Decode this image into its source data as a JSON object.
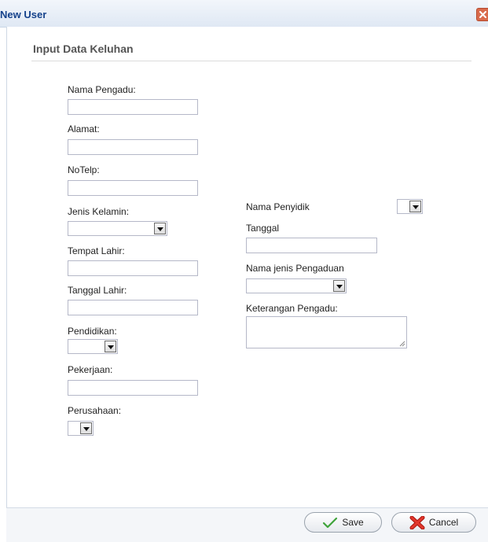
{
  "window": {
    "title": "New User"
  },
  "form": {
    "section_title": "Input Data Keluhan",
    "left": {
      "nama_pengadu": {
        "label": "Nama Pengadu:",
        "value": ""
      },
      "alamat": {
        "label": "Alamat:",
        "value": ""
      },
      "notelp": {
        "label": "NoTelp:",
        "value": ""
      },
      "jenis_kelamin": {
        "label": "Jenis Kelamin:",
        "value": ""
      },
      "tempat_lahir": {
        "label": "Tempat Lahir:",
        "value": ""
      },
      "tanggal_lahir": {
        "label": "Tanggal Lahir:",
        "value": ""
      },
      "pendidikan": {
        "label": "Pendidikan:",
        "value": ""
      },
      "pekerjaan": {
        "label": "Pekerjaan:",
        "value": ""
      },
      "perusahaan": {
        "label": "Perusahaan:",
        "value": ""
      }
    },
    "right": {
      "nama_penyidik": {
        "label": "Nama Penyidik",
        "value": ""
      },
      "tanggal": {
        "label": "Tanggal",
        "value": ""
      },
      "nama_jenis_pengaduan": {
        "label": "Nama jenis Pengaduan",
        "value": ""
      },
      "keterangan_pengadu": {
        "label": "Keterangan Pengadu:",
        "value": ""
      }
    }
  },
  "footer": {
    "save_label": "Save",
    "cancel_label": "Cancel"
  },
  "icons": {
    "close": "close-icon",
    "save": "checkmark-icon",
    "cancel": "red-x-icon",
    "dropdown": "chevron-down-icon",
    "resize": "resize-grip-icon"
  },
  "colors": {
    "title_text": "#15428b",
    "close_button": "#d96b4c",
    "save_check": "#3fa33a",
    "cancel_x": "#d8261e"
  }
}
